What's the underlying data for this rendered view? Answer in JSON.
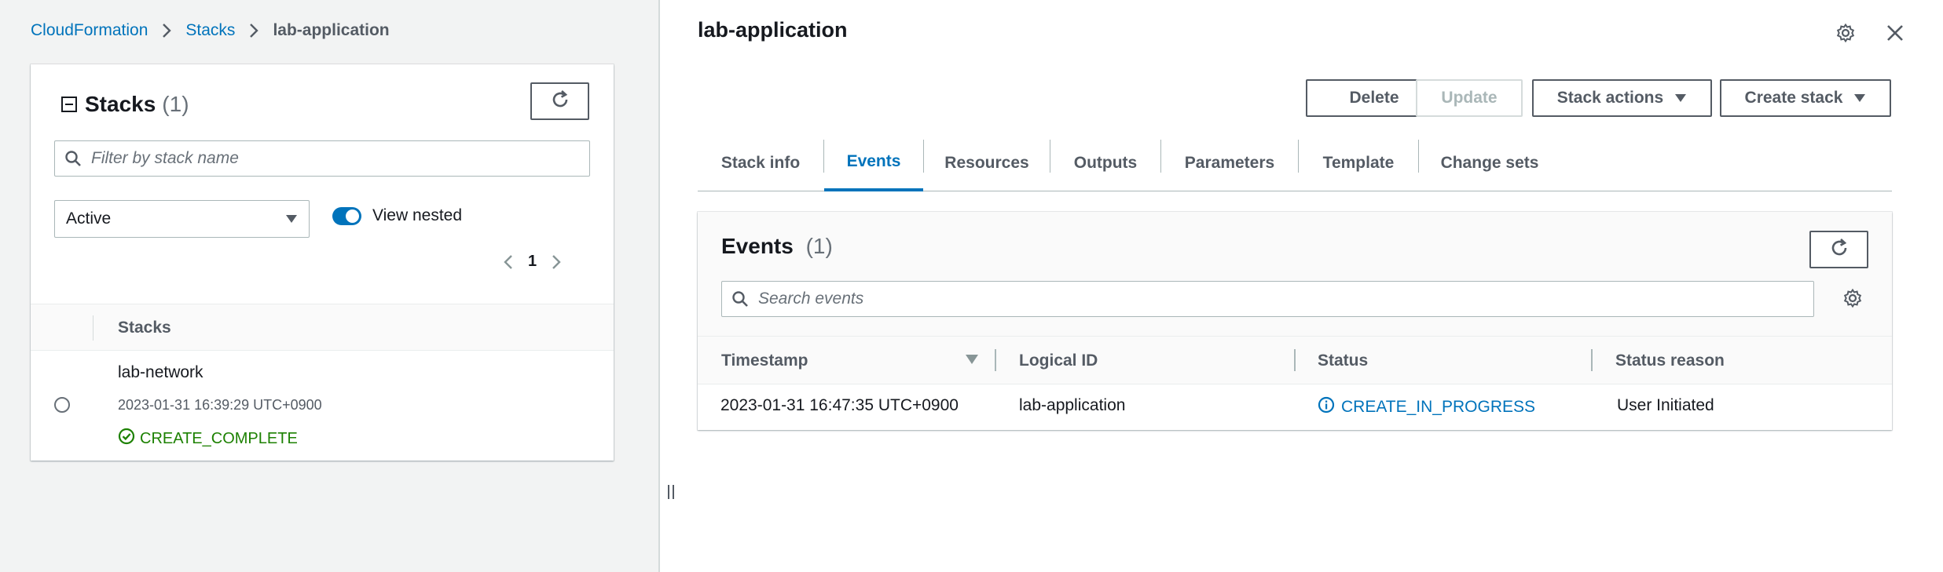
{
  "breadcrumb": {
    "items": [
      "CloudFormation",
      "Stacks"
    ],
    "current": "lab-application"
  },
  "stacks_panel": {
    "title": "Stacks",
    "count": "(1)",
    "search_placeholder": "Filter by stack name",
    "filter_selected": "Active",
    "view_nested_label": "View nested",
    "page": "1",
    "column_header": "Stacks",
    "rows": [
      {
        "name": "lab-network",
        "timestamp": "2023-01-31 16:39:29 UTC+0900",
        "status": "CREATE_COMPLETE"
      }
    ]
  },
  "detail": {
    "title": "lab-application",
    "buttons": {
      "delete": "Delete",
      "update": "Update",
      "stack_actions": "Stack actions",
      "create_stack": "Create stack"
    },
    "tabs": [
      "Stack info",
      "Events",
      "Resources",
      "Outputs",
      "Parameters",
      "Template",
      "Change sets"
    ],
    "active_tab": "Events"
  },
  "events_panel": {
    "title": "Events",
    "count": "(1)",
    "search_placeholder": "Search events",
    "columns": [
      "Timestamp",
      "Logical ID",
      "Status",
      "Status reason"
    ],
    "rows": [
      {
        "timestamp": "2023-01-31 16:47:35 UTC+0900",
        "logical_id": "lab-application",
        "status": "CREATE_IN_PROGRESS",
        "reason": "User Initiated"
      }
    ]
  },
  "colors": {
    "link": "#0073bb",
    "success": "#1d8102",
    "text": "#16191f",
    "muted": "#545b64"
  },
  "icons": [
    "chevron-right-icon",
    "refresh-icon",
    "search-icon",
    "caret-down-icon",
    "settings-icon",
    "close-icon",
    "info-icon",
    "check-circle-icon"
  ]
}
